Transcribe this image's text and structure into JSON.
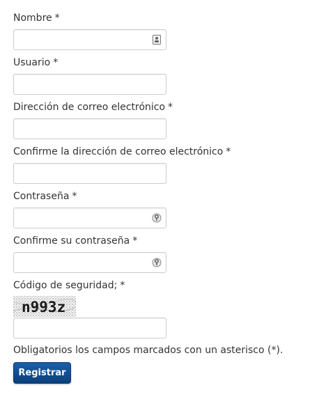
{
  "form": {
    "name": {
      "label": "Nombre",
      "required_mark": "*",
      "value": "",
      "icon": "contact-card-icon"
    },
    "username": {
      "label": "Usuario",
      "required_mark": "*",
      "value": ""
    },
    "email": {
      "label": "Dirección de correo electrónico",
      "required_mark": "*",
      "value": ""
    },
    "email_confirm": {
      "label": "Confirme la dirección de correo electrónico",
      "required_mark": "*",
      "value": ""
    },
    "password": {
      "label": "Contraseña",
      "required_mark": "*",
      "value": "",
      "icon": "password-key-icon"
    },
    "password_confirm": {
      "label": "Confirme su contraseña",
      "required_mark": "*",
      "value": "",
      "icon": "password-key-icon"
    },
    "captcha": {
      "label": "Código de seguridad;",
      "required_mark": "*",
      "image_text": "n993z",
      "value": ""
    },
    "required_note": "Obligatorios los campos marcados con un asterisco (*).",
    "submit_label": "Registrar"
  },
  "colors": {
    "text": "#333333",
    "field_border": "#cccccc",
    "button_top": "#1c5fa8",
    "button_bottom": "#0c3f7b"
  }
}
